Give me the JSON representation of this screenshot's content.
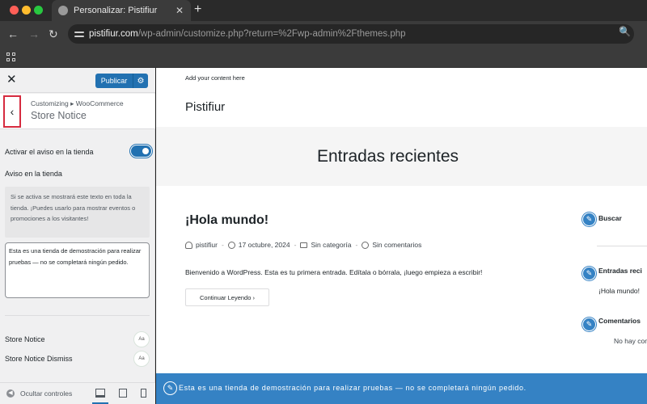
{
  "browser": {
    "tab_title": "Personalizar: Pistifiur",
    "tab_close": "✕",
    "new_tab": "+",
    "url_host": "pistifiur.com",
    "url_path": "/wp-admin/customize.php?return=%2Fwp-admin%2Fthemes.php",
    "back": "←",
    "forward": "→",
    "reload": "↻",
    "zoom_icon": "🔍"
  },
  "customizer": {
    "close": "✕",
    "publish_label": "Publicar",
    "publish_gear": "⚙",
    "back_glyph": "‹",
    "breadcrumb": "Customizing ▸ WooCommerce",
    "section_name": "Store Notice",
    "toggle_label": "Activar el aviso en la tienda",
    "toggle_on": true,
    "notice_label": "Aviso en la tienda",
    "description": "Si se activa se mostrará este texto en toda la tienda. ¡Puedes usarlo para mostrar eventos o promociones a los visitantes!",
    "notice_text": "Esta es una tienda de demostración para realizar pruebas — no se completará ningún pedido.",
    "typography": [
      {
        "label": "Store Notice",
        "button": "Aa"
      },
      {
        "label": "Store Notice Dismiss",
        "button": "Aa"
      }
    ],
    "footer": {
      "collapse_icon": "◀",
      "collapse_label": "Ocultar controles",
      "devices": [
        "desktop",
        "tablet",
        "mobile"
      ],
      "active_device": "desktop"
    },
    "colors": {
      "primary": "#2271b1",
      "highlight": "#d62b3f"
    }
  },
  "preview": {
    "tagline": "Add your content here",
    "site_title": "Pistifiur",
    "hero_title": "Entradas recientes",
    "post": {
      "title": "¡Hola mundo!",
      "author": "pistifiur",
      "date": "17 octubre, 2024",
      "category": "Sin categoría",
      "comments": "Sin comentarios",
      "excerpt": "Bienvenido a WordPress. Esta es tu primera entrada. Edítala o bórrala, ¡luego empieza a escribir!",
      "read_more": "Continuar Leyendo ›"
    },
    "widgets": {
      "pencil": "✎",
      "search_title": "Buscar",
      "recent_title": "Entradas reci",
      "recent_link": "¡Hola mundo!",
      "comments_title": "Comentarios",
      "comments_empty": "No hay com"
    },
    "store_notice": {
      "pencil": "✎",
      "text": "Esta es una tienda de demostración para realizar pruebas — no se completará ningún pedido.",
      "color": "#3582c4"
    }
  }
}
